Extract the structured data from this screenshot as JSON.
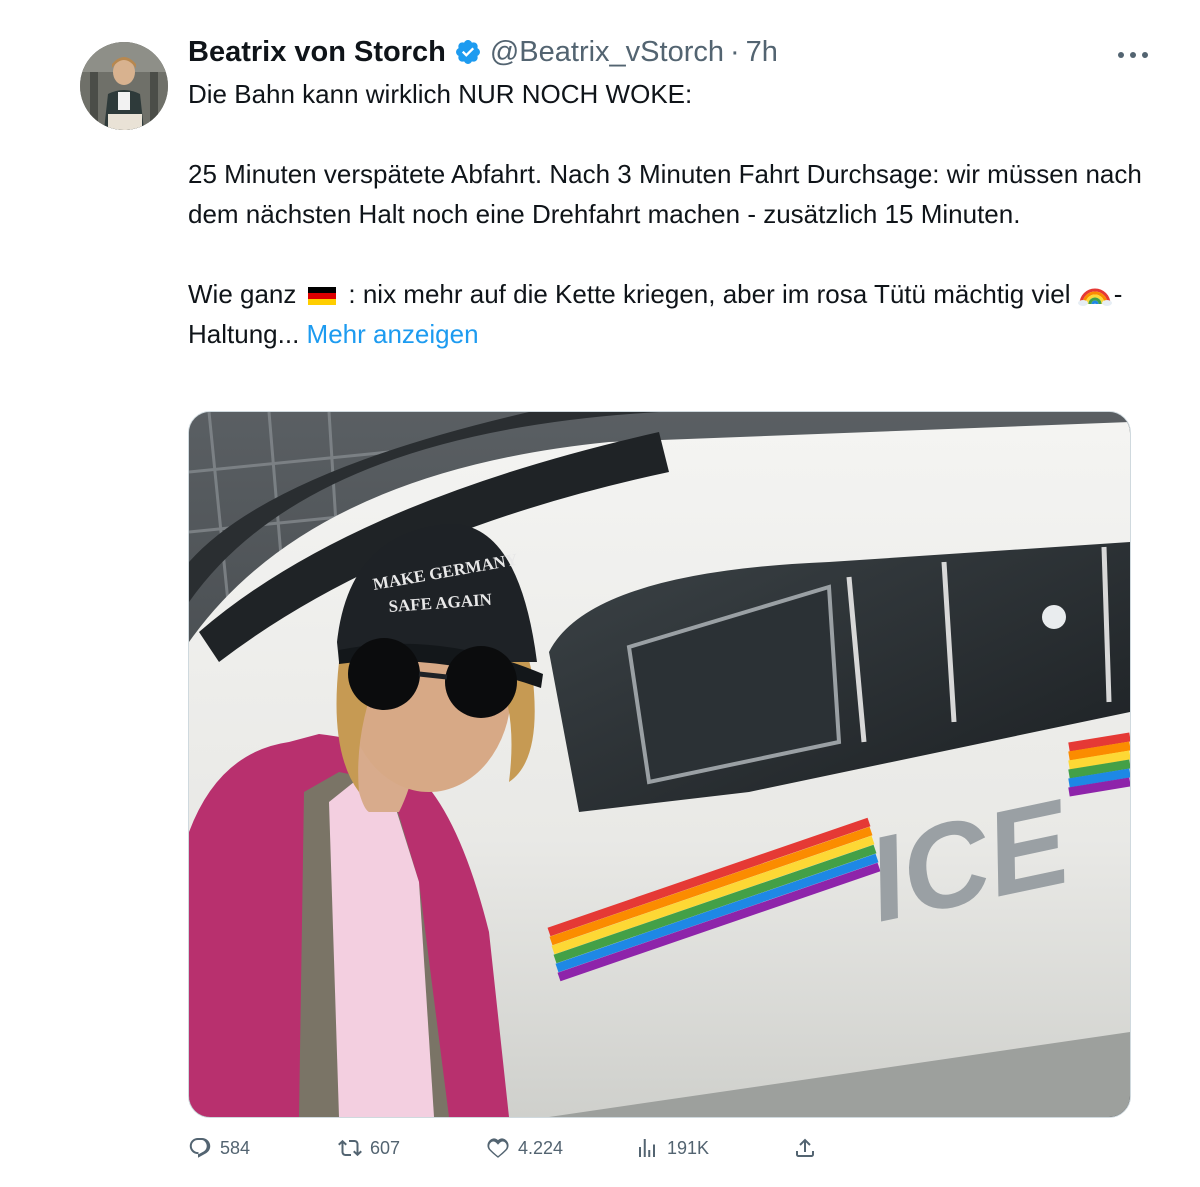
{
  "tweet": {
    "author_name": "Beatrix von Storch",
    "handle": "@Beatrix_vStorch",
    "separator": "·",
    "time": "7h",
    "lines": {
      "l1": "Die Bahn kann wirklich NUR NOCH WOKE:",
      "l2": "25 Minuten verspätete Abfahrt. Nach 3 Minuten Fahrt Durchsage: wir müssen nach dem nächsten Halt noch eine Drehfahrt machen - zusätzlich 15 Minuten.",
      "l3_a": "Wie ganz",
      "l3_b": ": nix mehr auf die Kette kriegen, aber im rosa Tütü mächtig viel",
      "l3_c": "- Haltung...",
      "show_more": "Mehr anzeigen"
    },
    "emojis": [
      "german-flag",
      "rainbow"
    ]
  },
  "media": {
    "cap_text_line1": "MAKE GERMANY",
    "cap_text_line2": "SAFE AGAIN",
    "train_text": "ICE"
  },
  "actions": {
    "replies": "584",
    "retweets": "607",
    "likes": "4.224",
    "views": "191K"
  },
  "colors": {
    "text": "#0f1419",
    "secondary": "#536471",
    "link": "#1d9bf0",
    "verified": "#1d9bf0"
  }
}
